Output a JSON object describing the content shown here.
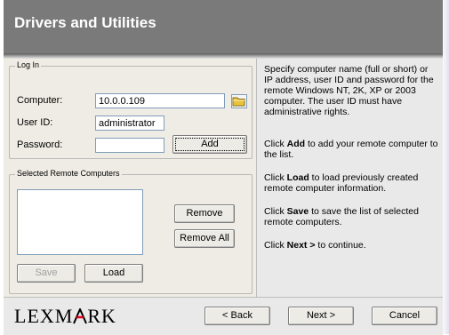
{
  "header": {
    "title": "Drivers and Utilities"
  },
  "login": {
    "legend": "Log In",
    "computer_label": "Computer:",
    "computer_value": "10.0.0.109",
    "userid_label": "User ID:",
    "userid_value": "administrator",
    "password_label": "Password:",
    "password_value": "",
    "add_label": "Add"
  },
  "selected": {
    "legend": "Selected Remote Computers",
    "items": [],
    "remove_label": "Remove",
    "remove_all_label": "Remove All",
    "save_label": "Save",
    "load_label": "Load"
  },
  "instructions": {
    "p1": "Specify computer name (full or short) or IP address, user ID and password for the remote Windows NT, 2K, XP or 2003 computer. The user ID must have administrative rights.",
    "p2_pre": "Click ",
    "p2_bold": "Add",
    "p2_post": " to add your remote computer to the list.",
    "p3_pre": "Click ",
    "p3_bold": "Load",
    "p3_post": " to load previously created remote computer information.",
    "p4_pre": "Click ",
    "p4_bold": "Save",
    "p4_post": " to save the list of selected remote computers.",
    "p5_pre": "Click ",
    "p5_bold": "Next >",
    "p5_post": " to continue."
  },
  "footer": {
    "logo_left": "LEXM",
    "logo_right": "RK",
    "back_label": "< Back",
    "next_label": "Next >",
    "cancel_label": "Cancel"
  },
  "colors": {
    "header_bg": "#7a7a7a",
    "logo_accent": "#e2001a",
    "folder_icon": "#e8c23c"
  },
  "icons": {
    "browse": "folder-icon",
    "logo_mark": "lexmark-logo"
  }
}
